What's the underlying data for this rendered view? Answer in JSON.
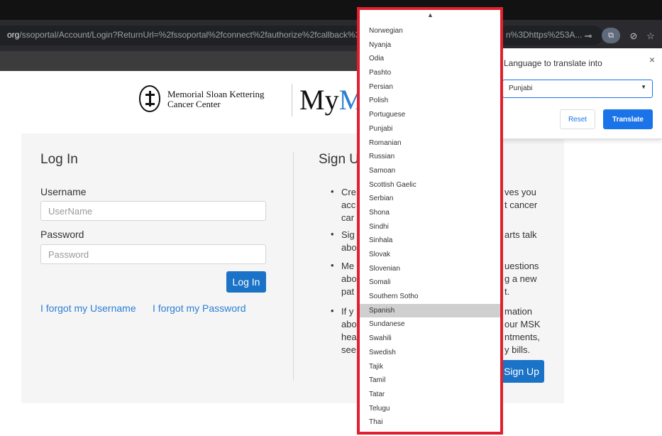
{
  "browser": {
    "url_domain": "org",
    "url_path": "/ssoportal/Account/Login?ReturnUrl=%2fssoportal%2fconnect%2fauthorize%2fcallback%3",
    "url_tail": "n%3Dhttps%253A..."
  },
  "header": {
    "org_line1": "Memorial Sloan Kettering",
    "org_line2": "Cancer Center",
    "brand_my": "My",
    "brand_m": "M"
  },
  "login": {
    "title": "Log In",
    "username_label": "Username",
    "username_placeholder": "UserName",
    "password_label": "Password",
    "password_placeholder": "Password",
    "login_button": "Log In",
    "forgot_username": "I forgot my Username",
    "forgot_password": "I forgot my Password"
  },
  "signup": {
    "title_visible": "Sign U",
    "bullets": [
      {
        "left": [
          "Cre",
          "acc",
          "car"
        ],
        "right": [
          "ves you",
          "t cancer",
          ""
        ]
      },
      {
        "left": [
          "Sig",
          "abo"
        ],
        "right": [
          "arts talk",
          ""
        ]
      },
      {
        "left": [
          "Me",
          "abo",
          "pat"
        ],
        "right": [
          "uestions",
          "g a new",
          "t."
        ]
      },
      {
        "left": [
          "If y",
          "abo",
          "hea",
          "see"
        ],
        "right": [
          "mation",
          "our MSK",
          "ntments,",
          "y bills."
        ]
      }
    ],
    "signup_button": "Sign Up"
  },
  "translate_popup": {
    "title": "Language to translate into",
    "selected_language": "Punjabi",
    "reset_button": "Reset",
    "translate_button": "Translate",
    "close_symbol": "×"
  },
  "language_dropdown": {
    "selected": "Spanish",
    "items": [
      "Norwegian",
      "Nyanja",
      "Odia",
      "Pashto",
      "Persian",
      "Polish",
      "Portuguese",
      "Punjabi",
      "Romanian",
      "Russian",
      "Samoan",
      "Scottish Gaelic",
      "Serbian",
      "Shona",
      "Sindhi",
      "Sinhala",
      "Slovak",
      "Slovenian",
      "Somali",
      "Southern Sotho",
      "Spanish",
      "Sundanese",
      "Swahili",
      "Swedish",
      "Tajik",
      "Tamil",
      "Tatar",
      "Telugu",
      "Thai"
    ]
  },
  "colors": {
    "accent_blue": "#1a73c6",
    "link_blue": "#2a7fd4",
    "highlight_border": "#e0202e"
  }
}
